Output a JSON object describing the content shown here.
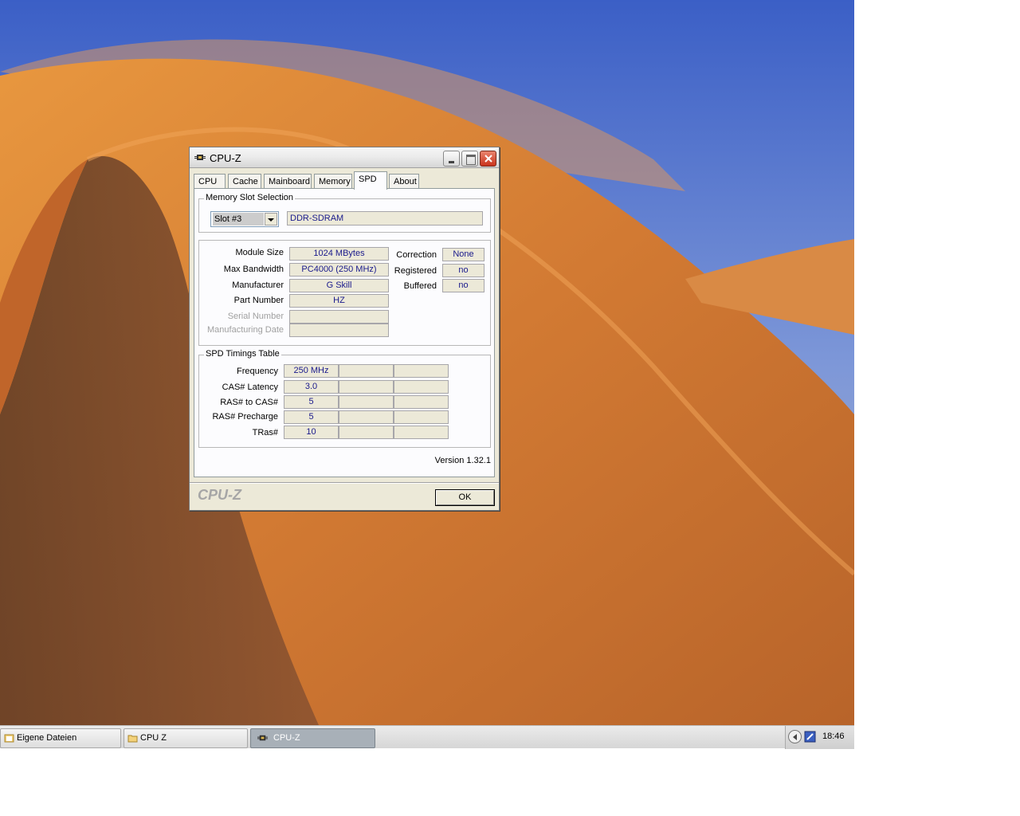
{
  "window": {
    "title": "CPU-Z",
    "icon": "cpu-chip-icon"
  },
  "tabs": [
    {
      "label": "CPU"
    },
    {
      "label": "Cache"
    },
    {
      "label": "Mainboard"
    },
    {
      "label": "Memory"
    },
    {
      "label": "SPD",
      "active": true
    },
    {
      "label": "About"
    }
  ],
  "slot_selection": {
    "group_title": "Memory Slot Selection",
    "selected_slot": "Slot #3",
    "memory_type": "DDR-SDRAM"
  },
  "module": {
    "labels": {
      "module_size": "Module Size",
      "max_bandwidth": "Max Bandwidth",
      "manufacturer": "Manufacturer",
      "part_number": "Part Number",
      "serial_number": "Serial Number",
      "manufacturing_date": "Manufacturing Date",
      "correction": "Correction",
      "registered": "Registered",
      "buffered": "Buffered"
    },
    "values": {
      "module_size": "1024 MBytes",
      "max_bandwidth": "PC4000 (250 MHz)",
      "manufacturer": "G Skill",
      "part_number": "HZ",
      "serial_number": "",
      "manufacturing_date": "",
      "correction": "None",
      "registered": "no",
      "buffered": "no"
    }
  },
  "timings": {
    "group_title": "SPD Timings Table",
    "rows": [
      {
        "label": "Frequency",
        "values": [
          "250 MHz",
          "",
          ""
        ]
      },
      {
        "label": "CAS# Latency",
        "values": [
          "3.0",
          "",
          ""
        ]
      },
      {
        "label": "RAS# to CAS#",
        "values": [
          "5",
          "",
          ""
        ]
      },
      {
        "label": "RAS# Precharge",
        "values": [
          "5",
          "",
          ""
        ]
      },
      {
        "label": "TRas#",
        "values": [
          "10",
          "",
          ""
        ]
      }
    ]
  },
  "version": "Version 1.32.1",
  "brand": "CPU-Z",
  "ok_label": "OK",
  "taskbar": {
    "items": [
      {
        "label": "Eigene Dateien",
        "icon": "folder-documents-icon"
      },
      {
        "label": "CPU Z",
        "icon": "folder-icon"
      },
      {
        "label": "CPU-Z",
        "icon": "cpu-chip-icon",
        "active": true
      }
    ],
    "clock": "18:46"
  }
}
